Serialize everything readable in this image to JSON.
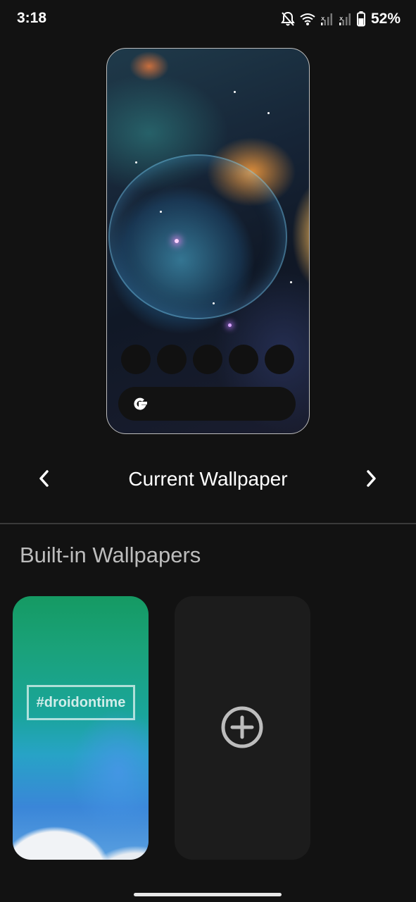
{
  "status_bar": {
    "time": "3:18",
    "battery": "52%",
    "icons": [
      "bell-off-icon",
      "wifi-icon",
      "signal-icon",
      "signal-icon",
      "battery-icon"
    ]
  },
  "preview": {
    "dock_icon_count": 5,
    "search_icon": "google-g-icon",
    "colors": {
      "frame": "#bdbdbd",
      "dock": "#111111"
    }
  },
  "nav": {
    "title": "Current Wallpaper",
    "prev_icon": "chevron-left-icon",
    "next_icon": "chevron-right-icon"
  },
  "section": {
    "title": "Built-in Wallpapers"
  },
  "wallpapers": [
    {
      "watermark": "#droidontime"
    }
  ],
  "add_card": {
    "icon": "add-circle-icon"
  },
  "theme": {
    "background": "#121212",
    "card": "#1c1c1c",
    "divider": "#3a3a3a",
    "muted_text": "#bdbdbd"
  }
}
